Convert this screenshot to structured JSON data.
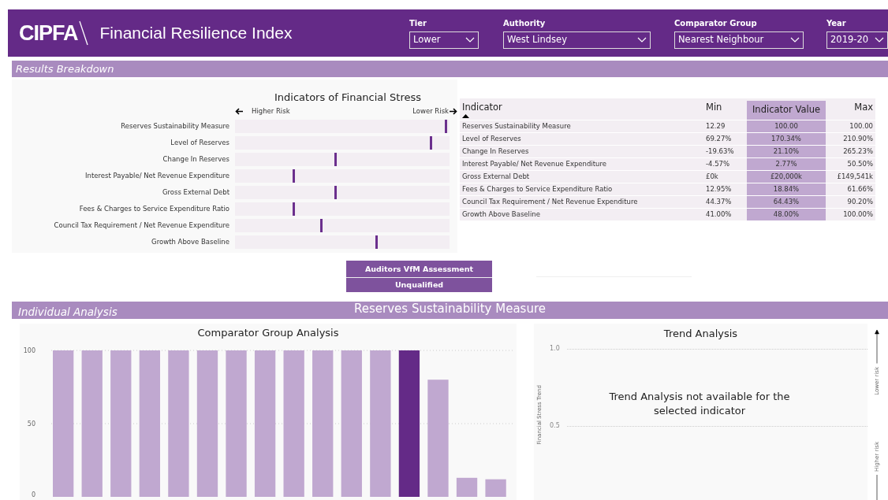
{
  "header": {
    "logo": "CIPFA",
    "title": "Financial Resilience Index",
    "filters": [
      {
        "label": "Tier",
        "value": "Lower"
      },
      {
        "label": "Authority",
        "value": "West Lindsey"
      },
      {
        "label": "Comparator Group",
        "value": "Nearest Neighbour"
      },
      {
        "label": "Year",
        "value": "2019-20"
      }
    ]
  },
  "results_breakdown": {
    "heading": "Results Breakdown",
    "stress_chart": {
      "title": "Indicators of Financial Stress",
      "left_label": "Higher Risk",
      "right_label": "Lower Risk",
      "rows": [
        {
          "label": "Reserves Sustainability Measure",
          "level": 0.99
        },
        {
          "label": "Level of Reserves",
          "level": 0.92
        },
        {
          "label": "Change In Reserves",
          "level": 0.47
        },
        {
          "label": "Interest Payable/ Net Revenue Expenditure",
          "level": 0.27
        },
        {
          "label": "Gross External Debt",
          "level": 0.47
        },
        {
          "label": "Fees & Charges to Service Expenditure Ratio",
          "level": 0.27
        },
        {
          "label": "Council Tax Requirement / Net Revenue Expenditure",
          "level": 0.4
        },
        {
          "label": "Growth Above Baseline",
          "level": 0.66
        }
      ]
    },
    "table": {
      "columns": [
        {
          "label": "Indicator",
          "sorted": true
        },
        {
          "label": "Min",
          "sorted": false
        },
        {
          "label": "Indicator Value",
          "sorted": false
        },
        {
          "label": "Max",
          "sorted": false
        }
      ],
      "rows": [
        {
          "indicator": "Reserves Sustainability Measure",
          "min": "12.29",
          "value": "100.00",
          "max": "100.00"
        },
        {
          "indicator": "Level of Reserves",
          "min": "69.27%",
          "value": "170.34%",
          "max": "210.90%"
        },
        {
          "indicator": "Change In Reserves",
          "min": "-19.63%",
          "value": "21.10%",
          "max": "265.23%"
        },
        {
          "indicator": "Interest Payable/ Net Revenue Expenditure",
          "min": "-4.57%",
          "value": "2.77%",
          "max": "50.50%"
        },
        {
          "indicator": "Gross External Debt",
          "min": "£0k",
          "value": "£20,000k",
          "max": "£149,541k"
        },
        {
          "indicator": "Fees & Charges to Service Expenditure Ratio",
          "min": "12.95%",
          "value": "18.84%",
          "max": "61.66%"
        },
        {
          "indicator": "Council Tax Requirement / Net Revenue Expenditure",
          "min": "44.37%",
          "value": "64.43%",
          "max": "90.20%"
        },
        {
          "indicator": "Growth Above Baseline",
          "min": "41.00%",
          "value": "48.00%",
          "max": "100.00%"
        }
      ]
    }
  },
  "auditors": {
    "title": "Auditors VfM Assessment",
    "value": "Unqualified"
  },
  "individual_analysis": {
    "heading": "Individual Analysis",
    "indicator": "Reserves Sustainability Measure",
    "comparator_chart": {
      "title": "Comparator Group Analysis",
      "chart_data": {
        "type": "bar",
        "ylim": [
          0,
          100
        ],
        "yticks": [
          0,
          50,
          100
        ],
        "series": [
          {
            "color": "#c0a8d0",
            "values": [
              100,
              100,
              100,
              100,
              100,
              100,
              100,
              100,
              100,
              100,
              100,
              100,
              null,
              80,
              13,
              12
            ]
          },
          {
            "color": "#642a87",
            "values": [
              null,
              null,
              null,
              null,
              null,
              null,
              null,
              null,
              null,
              null,
              null,
              null,
              100,
              null,
              null,
              null
            ]
          }
        ]
      }
    },
    "trend": {
      "title": "Trend Analysis",
      "ylabel": "Financial Stress Trend",
      "yticks": [
        "1.0",
        "0.5"
      ],
      "message": "Trend Analysis not available for the selected indicator",
      "top_label": "Lower risk",
      "bottom_label": "Higher risk"
    }
  }
}
